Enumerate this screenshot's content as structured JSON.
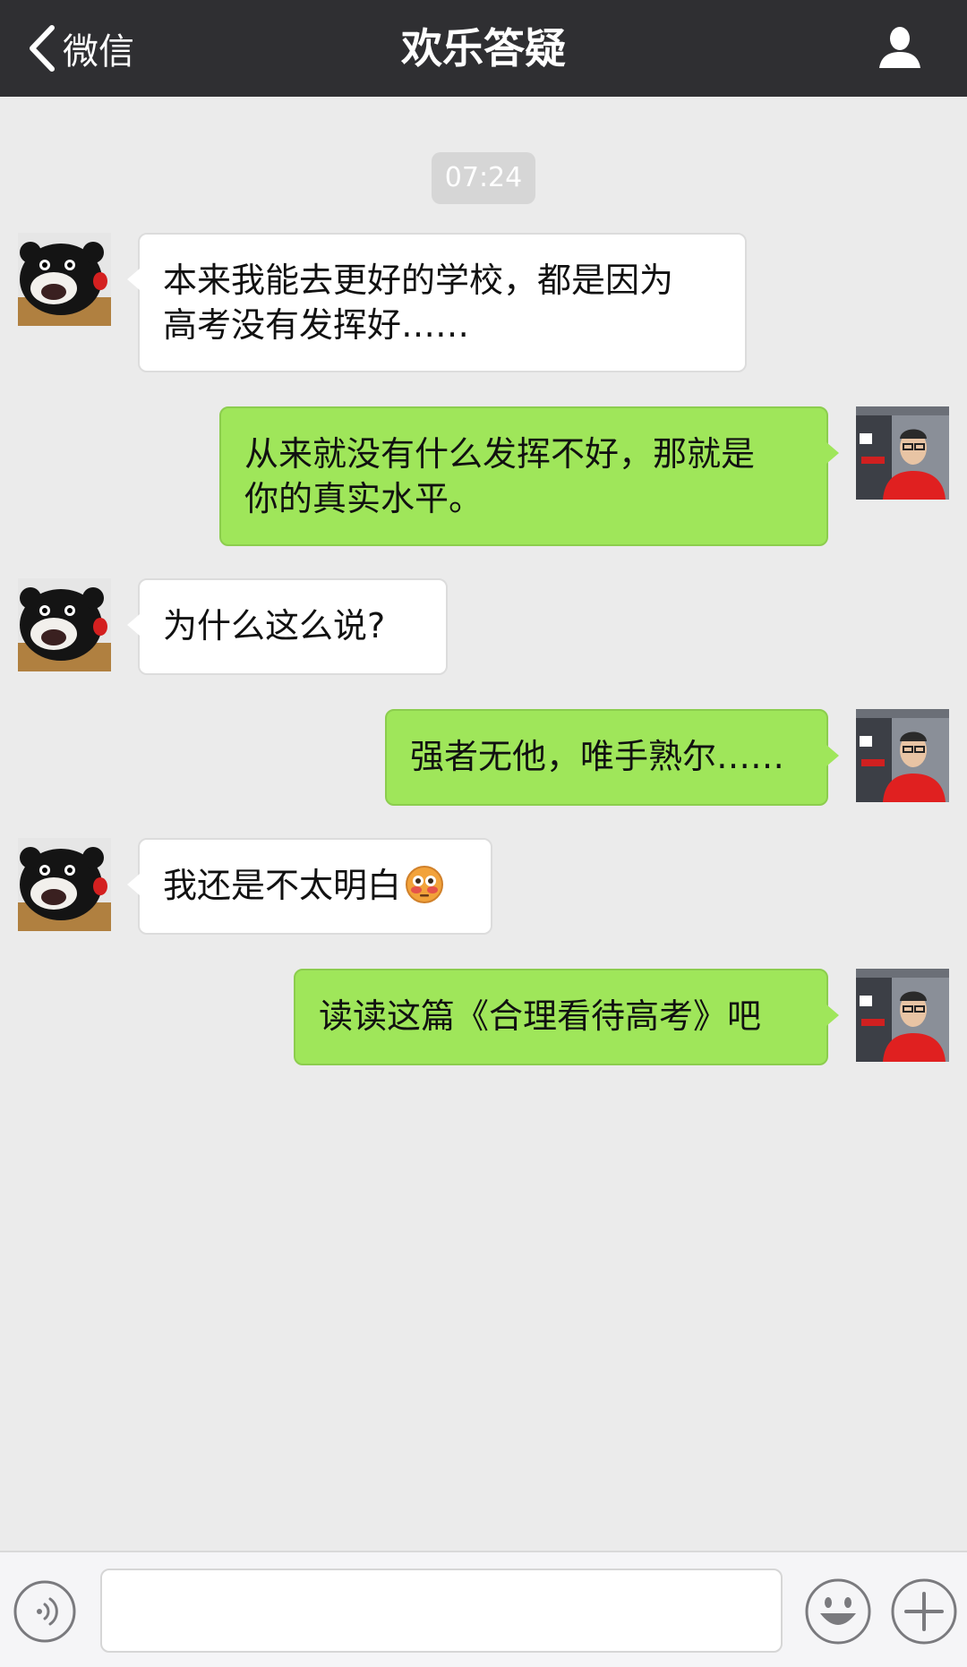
{
  "header": {
    "back_label": "微信",
    "title": "欢乐答疑",
    "back_icon": "chevron-left-icon",
    "profile_icon": "person-icon"
  },
  "chat": {
    "timestamp": "07:24",
    "messages": [
      {
        "side": "in",
        "sender": "kumamon",
        "text": "本来我能去更好的学校，都是因为\n高考没有发挥好……"
      },
      {
        "side": "out",
        "sender": "me",
        "text": "从来就没有什么发挥不好，那就是\n你的真实水平。"
      },
      {
        "side": "in",
        "sender": "kumamon",
        "text": "为什么这么说?"
      },
      {
        "side": "out",
        "sender": "me",
        "text": "强者无他，唯手熟尔……"
      },
      {
        "side": "in",
        "sender": "kumamon",
        "text": "我还是不太明白",
        "emoji": "flushed-face-emoji"
      },
      {
        "side": "out",
        "sender": "me",
        "text": "读读这篇《合理看待高考》吧"
      }
    ]
  },
  "input_bar": {
    "voice_icon": "voice-icon",
    "text_value": "",
    "emoji_icon": "smiley-icon",
    "plus_icon": "plus-icon"
  },
  "colors": {
    "header_bg": "#2f2f32",
    "chat_bg": "#ebebeb",
    "outgoing_bubble": "#9fe65a",
    "incoming_bubble": "#ffffff",
    "timestamp_bg": "#d6d6d6"
  }
}
